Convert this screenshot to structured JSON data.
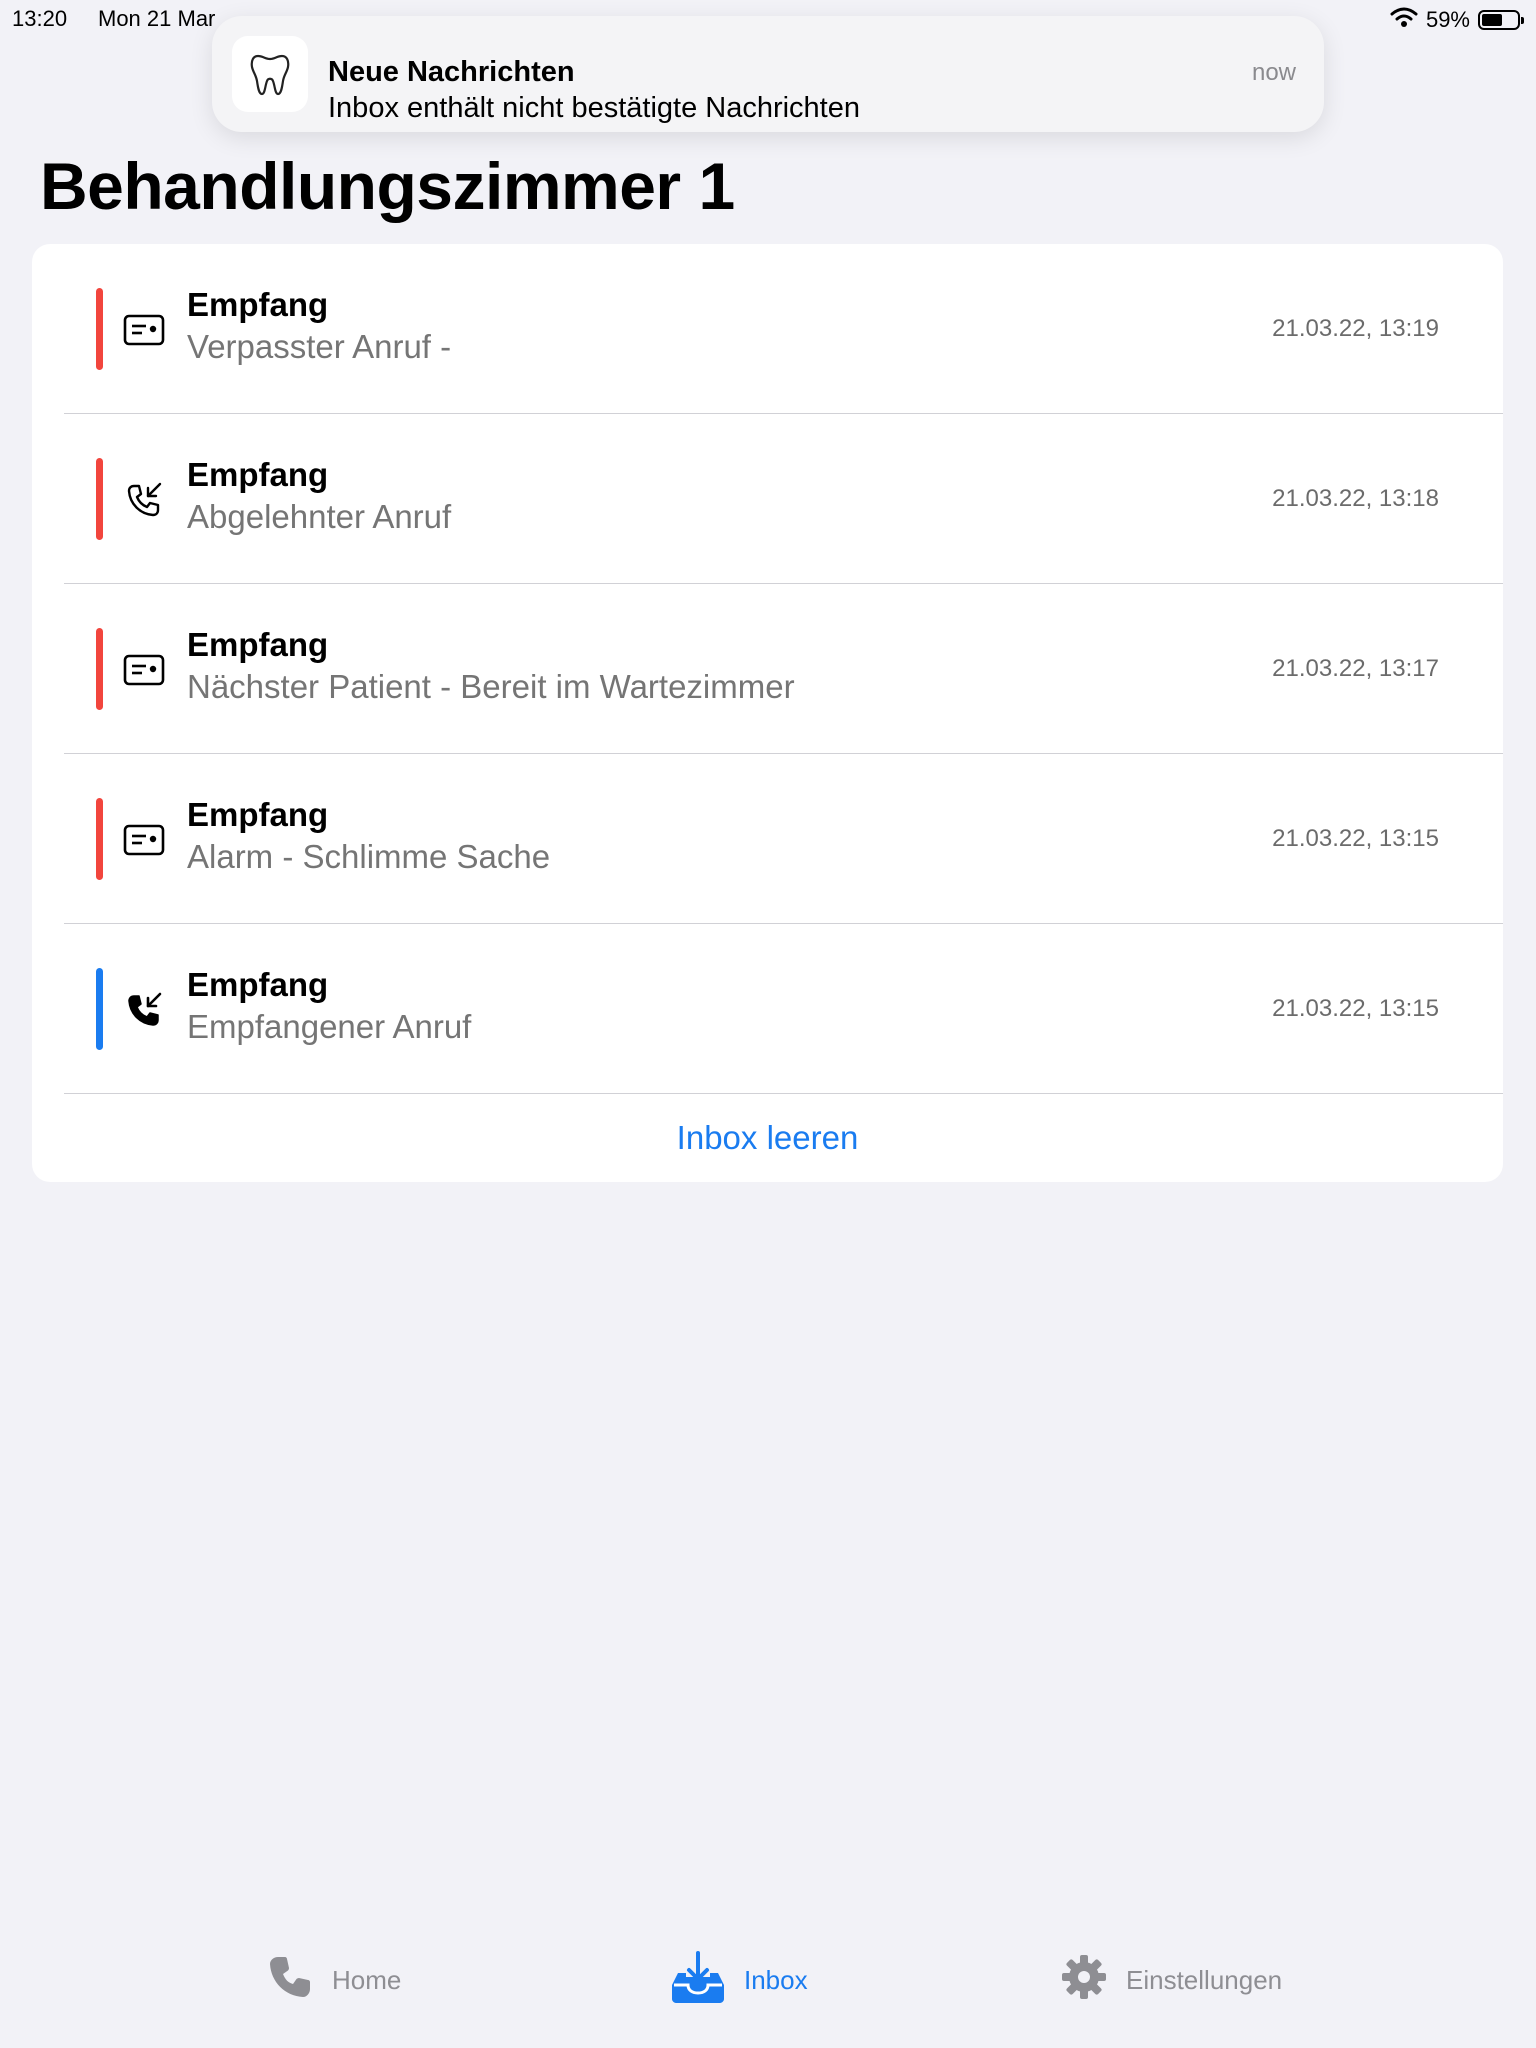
{
  "status_bar": {
    "time": "13:20",
    "date": "Mon 21 Mar",
    "battery": "59%",
    "battery_level": 0.59
  },
  "notification": {
    "title": "Neue Nachrichten",
    "body": "Inbox enthält nicht bestätigte Nachrichten",
    "time": "now",
    "icon": "tooth-icon"
  },
  "page": {
    "title": "Behandlungszimmer 1"
  },
  "messages": [
    {
      "title": "Empfang",
      "subtitle": "Verpasster Anruf -",
      "time": "21.03.22, 13:19",
      "icon": "message-card-icon",
      "indicator_color": "#f2453d"
    },
    {
      "title": "Empfang",
      "subtitle": "Abgelehnter Anruf",
      "time": "21.03.22, 13:18",
      "icon": "incoming-call-outline-icon",
      "indicator_color": "#f2453d"
    },
    {
      "title": "Empfang",
      "subtitle": "Nächster Patient - Bereit im Wartezimmer",
      "time": "21.03.22, 13:17",
      "icon": "message-card-icon",
      "indicator_color": "#f2453d"
    },
    {
      "title": "Empfang",
      "subtitle": "Alarm - Schlimme Sache",
      "time": "21.03.22, 13:15",
      "icon": "message-card-icon",
      "indicator_color": "#f2453d"
    },
    {
      "title": "Empfang",
      "subtitle": "Empfangener Anruf",
      "time": "21.03.22, 13:15",
      "icon": "incoming-call-filled-icon",
      "indicator_color": "#1a7cf0"
    }
  ],
  "clear_button": {
    "label": "Inbox leeren"
  },
  "tabs": [
    {
      "label": "Home",
      "icon": "phone-icon",
      "active": false
    },
    {
      "label": "Inbox",
      "icon": "inbox-tray-icon",
      "active": true
    },
    {
      "label": "Einstellungen",
      "icon": "gear-icon",
      "active": false
    }
  ],
  "colors": {
    "accent": "#1a7cf0",
    "alert": "#f2453d",
    "background": "#f2f2f7"
  }
}
